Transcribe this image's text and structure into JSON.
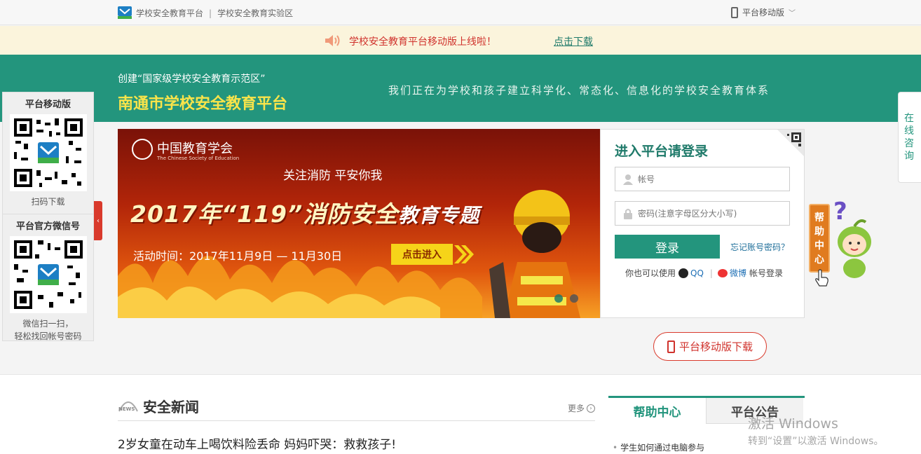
{
  "topbar": {
    "link1": "学校安全教育平台",
    "link2": "学校安全教育实验区",
    "mobile_label": "平台移动版",
    "chevron": "﹀"
  },
  "notice": {
    "text": "学校安全教育平台移动版上线啦！",
    "link": "点击下载"
  },
  "banner": {
    "sub": "创建“国家级学校安全教育示范区”",
    "title": "南通市学校安全教育平台",
    "slogan": "我们正在为学校和孩子建立科学化、常态化、信息化的学校安全教育体系"
  },
  "left_panel": {
    "mobile_title": "平台移动版",
    "mobile_caption": "扫码下载",
    "wechat_title": "平台官方微信号",
    "wechat_caption1": "微信扫一扫，",
    "wechat_caption2": "轻松找回帐号密码",
    "collapse": "‹"
  },
  "consult": [
    "在",
    "线",
    "咨",
    "询"
  ],
  "carousel": {
    "org_cn": "中国教育学会",
    "org_en": "The Chinese Society of Education",
    "slogan": "关注消防   平安你我",
    "headline_year": "2017年“119”消防安全",
    "headline_tail": "教育专题",
    "time": "活动时间：2017年11月9日 — 11月30日",
    "enter": "点击进入"
  },
  "login": {
    "title": "进入平台请登录",
    "account_placeholder": "帐号",
    "password_placeholder": "密码(注意字母区分大小写)",
    "button": "登录",
    "forgot": "忘记账号密码？",
    "alt_prefix": "你也可以使用",
    "qq": "QQ",
    "sep": "|",
    "weibo": "微博",
    "alt_suffix": "帐号登录"
  },
  "help_side": [
    "帮",
    "助",
    "中",
    "心"
  ],
  "mobile_download": "平台移动版下载",
  "news": {
    "icon_text": "NEWS",
    "title": "安全新闻",
    "more": "更多",
    "item1": "2岁女童在动车上喝饮料险丢命 妈妈吓哭：救救孩子!"
  },
  "help_tabs": {
    "tab1": "帮助中心",
    "tab2": "平台公告",
    "item1": "学生如何通过电脑参与"
  },
  "watermark": {
    "line1": "激活 Windows",
    "line2": "转到“设置”以激活 Windows。"
  },
  "colors": {
    "brand_green": "#23957d",
    "notice_red": "#d0322c",
    "title_yellow": "#f9e44a"
  }
}
